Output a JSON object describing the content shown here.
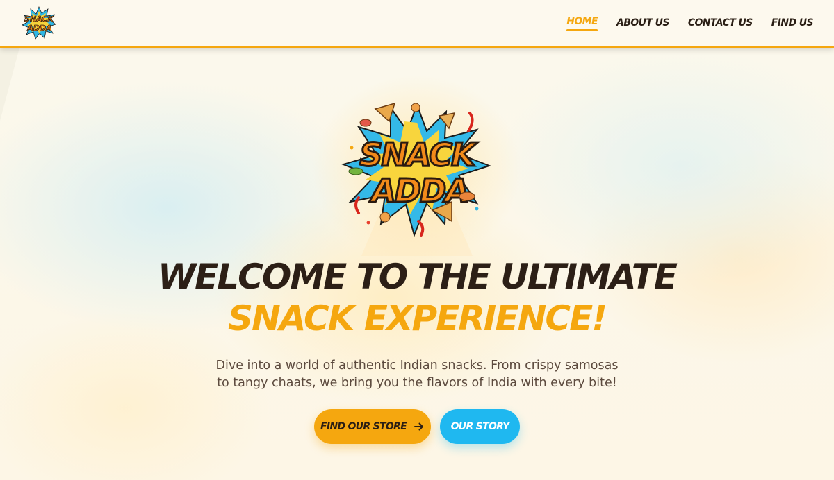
{
  "brand": {
    "logo_line1": "SNACK",
    "logo_line2": "ADDA",
    "colors": {
      "accent": "#f5a70f",
      "secondary": "#1fb8f0",
      "text_dark": "#2c1f16",
      "logo_burst": "#33b8e6"
    }
  },
  "nav": {
    "items": [
      {
        "label": "HOME",
        "active": true
      },
      {
        "label": "ABOUT US",
        "active": false
      },
      {
        "label": "CONTACT US",
        "active": false
      },
      {
        "label": "FIND US",
        "active": false
      }
    ]
  },
  "hero": {
    "headline_line1": "WELCOME TO THE ULTIMATE",
    "headline_line2": "SNACK EXPERIENCE!",
    "subtitle_line1": "Dive into a world of authentic Indian snacks. From crispy samosas",
    "subtitle_line2": "to tangy chaats, we bring you the flavors of India with every bite!",
    "primary_button": {
      "label": "FIND OUR STORE",
      "icon": "arrow-right-icon"
    },
    "secondary_button": {
      "label": "OUR STORY"
    }
  }
}
